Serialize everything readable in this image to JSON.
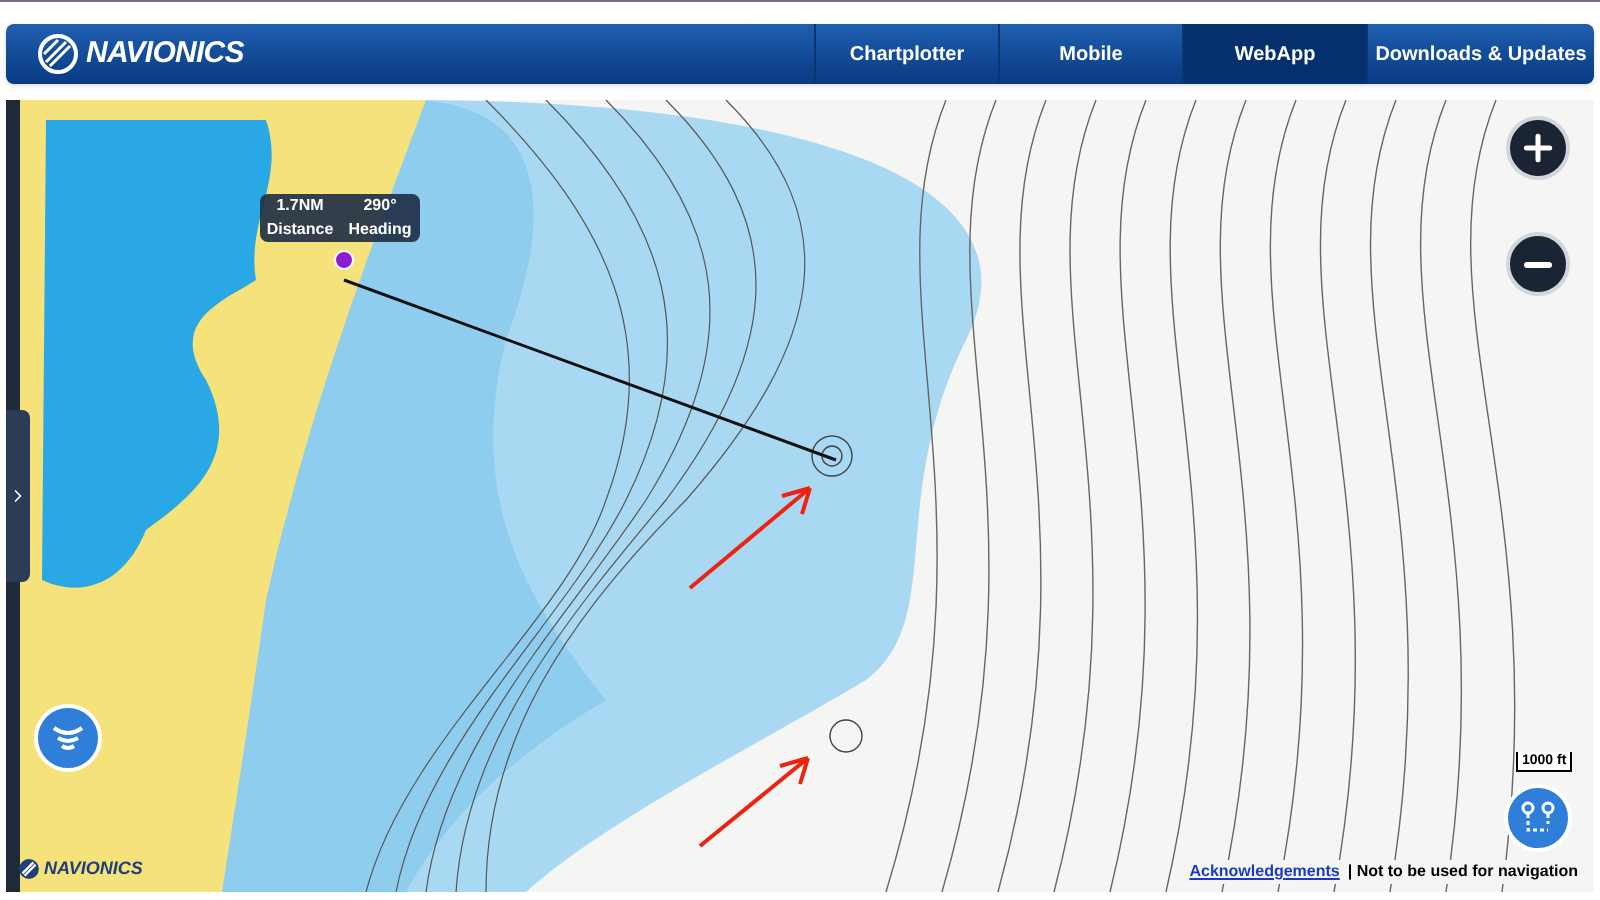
{
  "header": {
    "logo": "NAVIONICS",
    "tabs": [
      {
        "label": "Chartplotter",
        "selected": false
      },
      {
        "label": "Mobile",
        "selected": false
      },
      {
        "label": "WebApp",
        "selected": true
      },
      {
        "label": "Downloads & Updates",
        "selected": false
      }
    ]
  },
  "measure": {
    "distance": "1.7NM",
    "heading": "290°",
    "distance_label": "Distance",
    "heading_label": "Heading"
  },
  "scale": "1000 ft",
  "footer": {
    "link": "Acknowledgements",
    "note": "| Not to be used for navigation",
    "logo": "NAVIONICS"
  }
}
